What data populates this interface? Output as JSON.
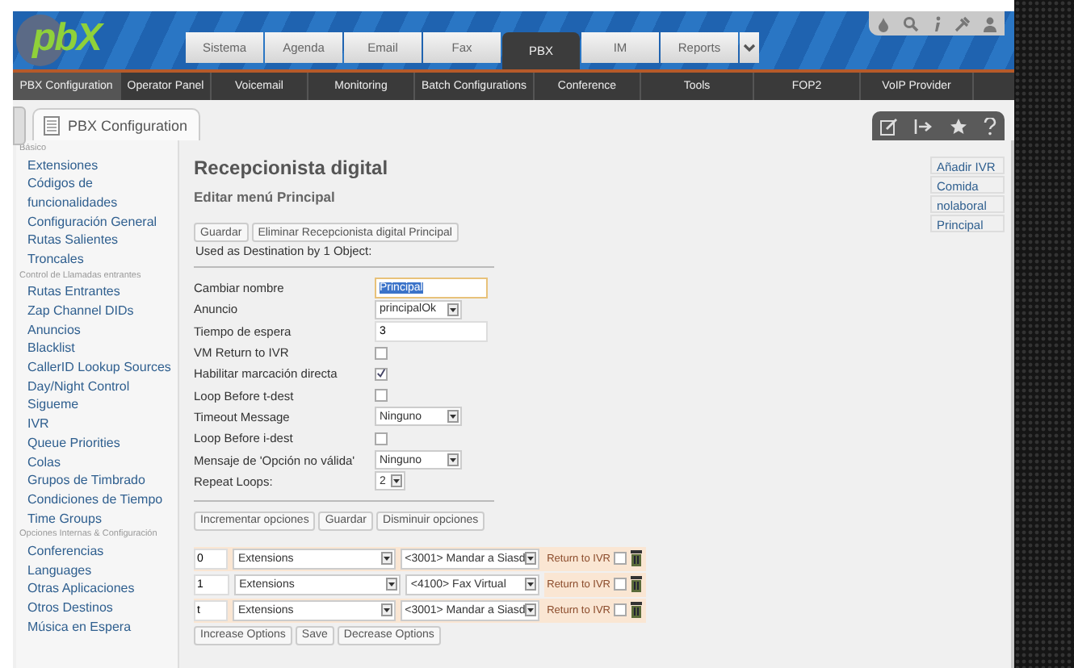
{
  "logo": {
    "text": "pbX"
  },
  "top_tabs": [
    {
      "label": "Sistema",
      "selected": false
    },
    {
      "label": "Agenda",
      "selected": false
    },
    {
      "label": "Email",
      "selected": false
    },
    {
      "label": "Fax",
      "selected": false
    },
    {
      "label": "PBX",
      "selected": true
    },
    {
      "label": "IM",
      "selected": false
    },
    {
      "label": "Reports",
      "selected": false
    }
  ],
  "menu": [
    {
      "label": "PBX Configuration",
      "selected": true
    },
    {
      "label": "Operator Panel",
      "selected": false
    },
    {
      "label": "Voicemail",
      "selected": false
    },
    {
      "label": "Monitoring",
      "selected": false
    },
    {
      "label": "Batch Configurations",
      "selected": false
    },
    {
      "label": "Conference",
      "selected": false
    },
    {
      "label": "Tools",
      "selected": false
    },
    {
      "label": "FOP2",
      "selected": false
    },
    {
      "label": "VoIP Provider",
      "selected": false
    }
  ],
  "panel_tab": {
    "label": "PBX Configuration"
  },
  "sidebar": {
    "groups": [
      {
        "title": "Básico",
        "items": [
          "Extensiones",
          "Códigos de funcionalidades",
          "Configuración General",
          "Rutas Salientes",
          "Troncales"
        ]
      },
      {
        "title": "Control de Llamadas entrantes",
        "items": [
          "Rutas Entrantes",
          "Zap Channel DIDs",
          "Anuncios",
          "Blacklist",
          "CallerID Lookup Sources",
          "Day/Night Control",
          "Sigueme",
          "IVR",
          "Queue Priorities",
          "Colas",
          "Grupos de Timbrado",
          "Condiciones de Tiempo",
          "Time Groups"
        ]
      },
      {
        "title": "Opciones Internas & Configuración",
        "items": [
          "Conferencias",
          "Languages",
          "Otras Aplicaciones",
          "Otros Destinos",
          "Música en Espera"
        ]
      }
    ]
  },
  "content": {
    "title": "Recepcionista digital",
    "subtitle": "Editar menú Principal",
    "top_buttons": [
      "Guardar",
      "Eliminar Recepcionista digital Principal"
    ],
    "used_as": "Used as Destination by 1 Object:",
    "fields": [
      {
        "kind": "text",
        "label": "Cambiar nombre",
        "value": "Principal",
        "highlighted": true
      },
      {
        "kind": "select",
        "label": "Anuncio",
        "value": "principalOk"
      },
      {
        "kind": "text",
        "label": "Tiempo de espera",
        "value": "3",
        "highlighted": false
      },
      {
        "kind": "checkbox",
        "label": "VM Return to IVR",
        "checked": false
      },
      {
        "kind": "checkbox",
        "label": "Habilitar marcación directa",
        "checked": true
      },
      {
        "kind": "checkbox",
        "label": "Loop Before t-dest",
        "checked": false
      },
      {
        "kind": "select",
        "label": "Timeout Message",
        "value": "Ninguno"
      },
      {
        "kind": "checkbox",
        "label": "Loop Before i-dest",
        "checked": false
      },
      {
        "kind": "select",
        "label": "Mensaje de 'Opción no válida'",
        "value": "Ninguno"
      },
      {
        "kind": "small-select",
        "label": "Repeat Loops:",
        "value": "2"
      }
    ],
    "option_buttons": [
      "Incrementar opciones",
      "Guardar",
      "Disminuir opciones"
    ],
    "options": [
      {
        "digit": "0",
        "type": "Extensions",
        "destination": "<3001> Mandar a Siasd",
        "return_label": "Return to IVR",
        "return_checked": false,
        "shaded": true
      },
      {
        "digit": "1",
        "type": "Extensions",
        "destination": "<4100> Fax Virtual",
        "return_label": "Return to IVR",
        "return_checked": false,
        "shaded": false
      },
      {
        "digit": "t",
        "type": "Extensions",
        "destination": "<3001> Mandar a Siasd",
        "return_label": "Return to IVR",
        "return_checked": false,
        "shaded": true
      }
    ],
    "bottom_buttons": [
      "Increase Options",
      "Save",
      "Decrease Options"
    ]
  },
  "ivr_list": [
    "Añadir IVR",
    "Comida",
    "nolaboral",
    "Principal"
  ]
}
